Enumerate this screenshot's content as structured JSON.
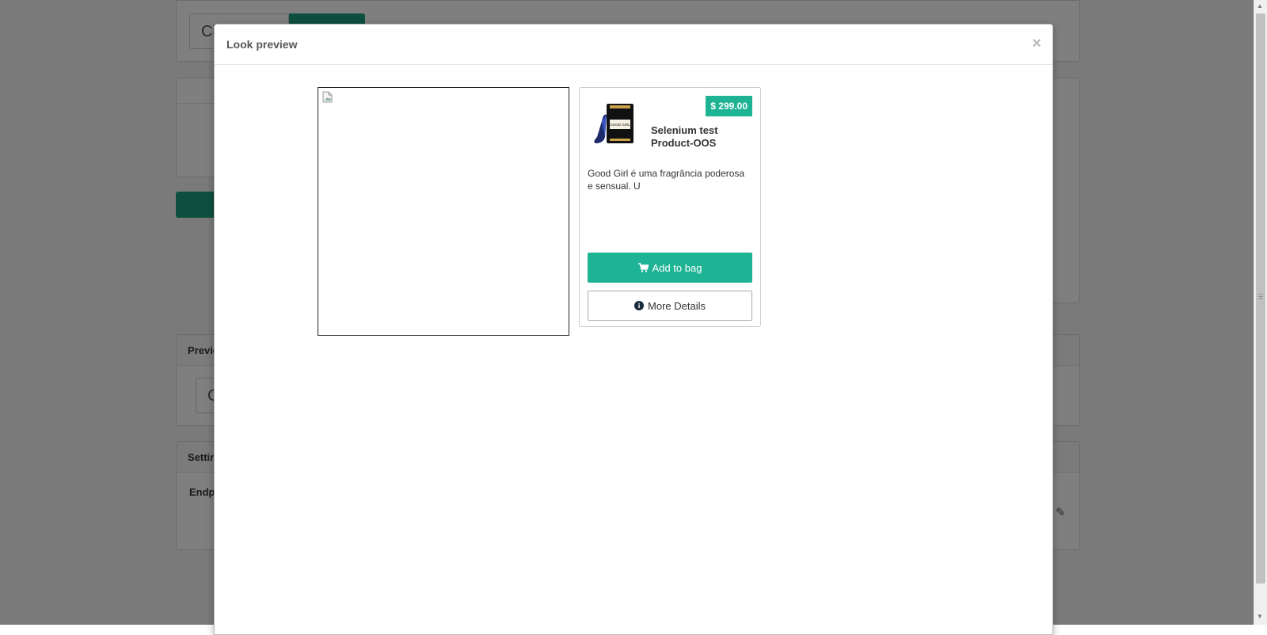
{
  "background": {
    "top_input_text": "Cl",
    "preview_panel_title": "Previe",
    "preview_input_text": "C",
    "settings_panel_title": "Settin",
    "endpoint_label": "Endpo"
  },
  "modal": {
    "title": "Look preview",
    "close_label": "×"
  },
  "product": {
    "price": "$ 299.00",
    "name": "Selenium test Product-OOS",
    "description": "Good Girl é uma fragrância poderosa e sensual. U",
    "add_to_bag_label": "Add to bag",
    "more_details_label": "More Details",
    "thumb_text": "GOOD GIRL"
  },
  "colors": {
    "accent": "#1db394",
    "bg_accent": "#1a9e7e"
  },
  "icons": {
    "close": "close-icon",
    "cart": "shopping-cart-icon",
    "info": "info-circle-icon",
    "broken_image": "broken-image-icon",
    "edit": "pencil-icon"
  }
}
